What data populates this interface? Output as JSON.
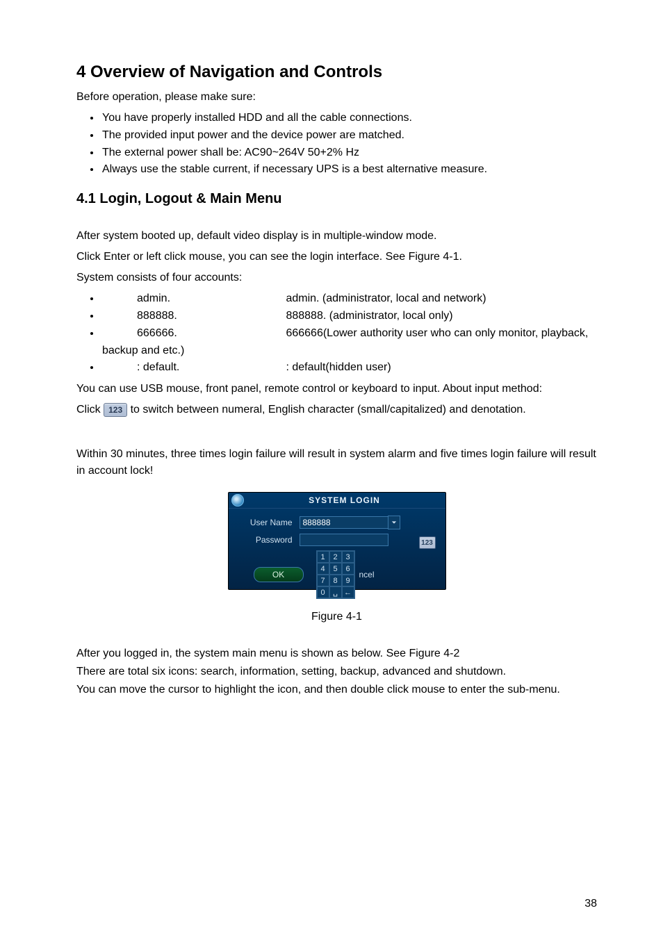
{
  "heading1": "4  Overview of Navigation and Controls",
  "intro": "Before operation, please make sure:",
  "bullets_top": [
    "You have properly installed HDD and all the cable connections.",
    "The provided input power and the device power are matched.",
    "The external power shall be: AC90~264V  50+2% Hz",
    "Always use the stable current, if necessary UPS is a best alternative measure."
  ],
  "heading2": "4.1   Login, Logout & Main Menu",
  "p_boot": "After system booted up, default video display is in multiple-window mode.",
  "p_click": "Click Enter or left click mouse, you can see the login interface. See Figure 4-1.",
  "p_sys": "System consists of four accounts:",
  "accounts": [
    {
      "name": "admin.",
      "desc": "admin. (administrator, local and network)"
    },
    {
      "name": "888888.",
      "desc": "888888. (administrator, local only)"
    },
    {
      "name": "666666.",
      "desc": "666666(Lower authority user who can only monitor, playback,"
    },
    {
      "name": ": default.",
      "desc": ": default(hidden user)"
    }
  ],
  "backup_line": "backup and etc.)",
  "p_input": "You can use USB mouse, front panel, remote control or keyboard to input. About input method:",
  "p_click2_pre": "Click ",
  "p_click2_post": " to switch between numeral, English character (small/capitalized) and denotation.",
  "icon_123": "123",
  "p_warn": "Within 30 minutes, three times login failure will result in system alarm and five times login failure will result in account lock!",
  "login": {
    "title": "SYSTEM LOGIN",
    "user_lbl": "User Name",
    "user_val": "888888",
    "pwd_lbl": "Password",
    "pwd_val": "",
    "ok": "OK",
    "cancel_hint": "ncel",
    "ime": "123",
    "keys": [
      [
        "1",
        "2",
        "3"
      ],
      [
        "4",
        "5",
        "6"
      ],
      [
        "7",
        "8",
        "9"
      ],
      [
        "0",
        "␣",
        "←"
      ]
    ]
  },
  "figure_caption": "Figure 4-1",
  "tail1": "After you logged in, the system main menu is shown as below. See Figure 4-2",
  "tail2": "There are total six icons: search, information, setting, backup, advanced and shutdown.",
  "tail3": "You can move the cursor to highlight the icon, and then double click mouse to enter the sub-menu.",
  "page_number": "38"
}
